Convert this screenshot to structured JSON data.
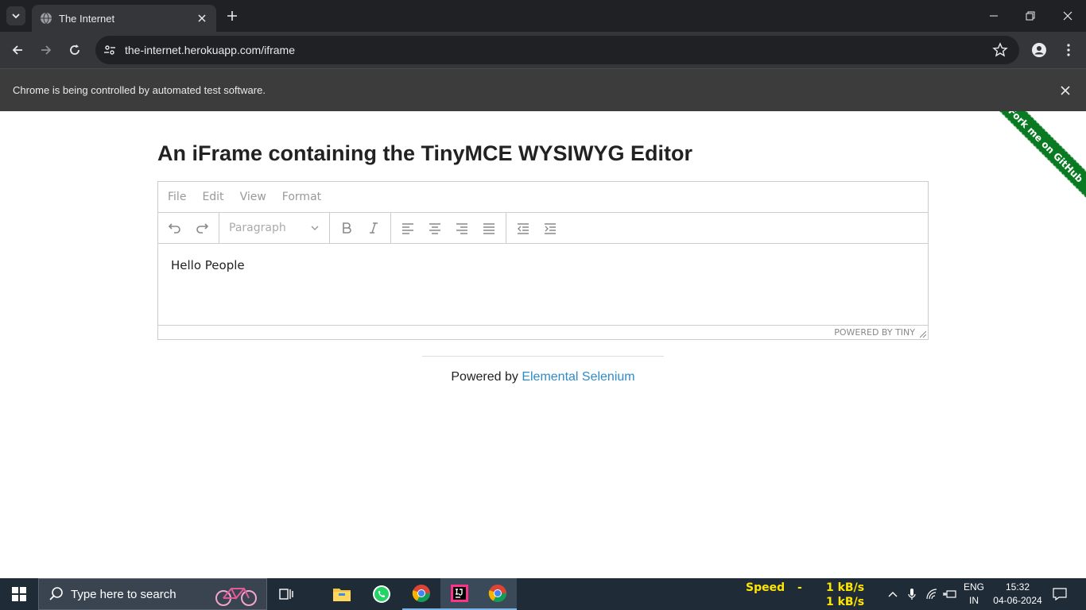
{
  "browser": {
    "tab_title": "The Internet",
    "url": "the-internet.herokuapp.com/iframe",
    "infobar_message": "Chrome is being controlled by automated test software."
  },
  "page": {
    "heading": "An iFrame containing the TinyMCE WYSIWYG Editor",
    "ribbon_text": "Fork me on GitHub",
    "editor": {
      "menu": [
        "File",
        "Edit",
        "View",
        "Format"
      ],
      "block_format": "Paragraph",
      "content": "Hello People",
      "status": "POWERED BY TINY"
    },
    "footer_prefix": "Powered by ",
    "footer_link": "Elemental Selenium"
  },
  "taskbar": {
    "search_placeholder": "Type here to search",
    "speed_label": "Speed",
    "speed_dash": "-",
    "upload": "1 kB/s",
    "download": "1 kB/s",
    "lang_top": "ENG",
    "lang_bottom": "IN",
    "time": "15:32",
    "date": "04-06-2024"
  }
}
